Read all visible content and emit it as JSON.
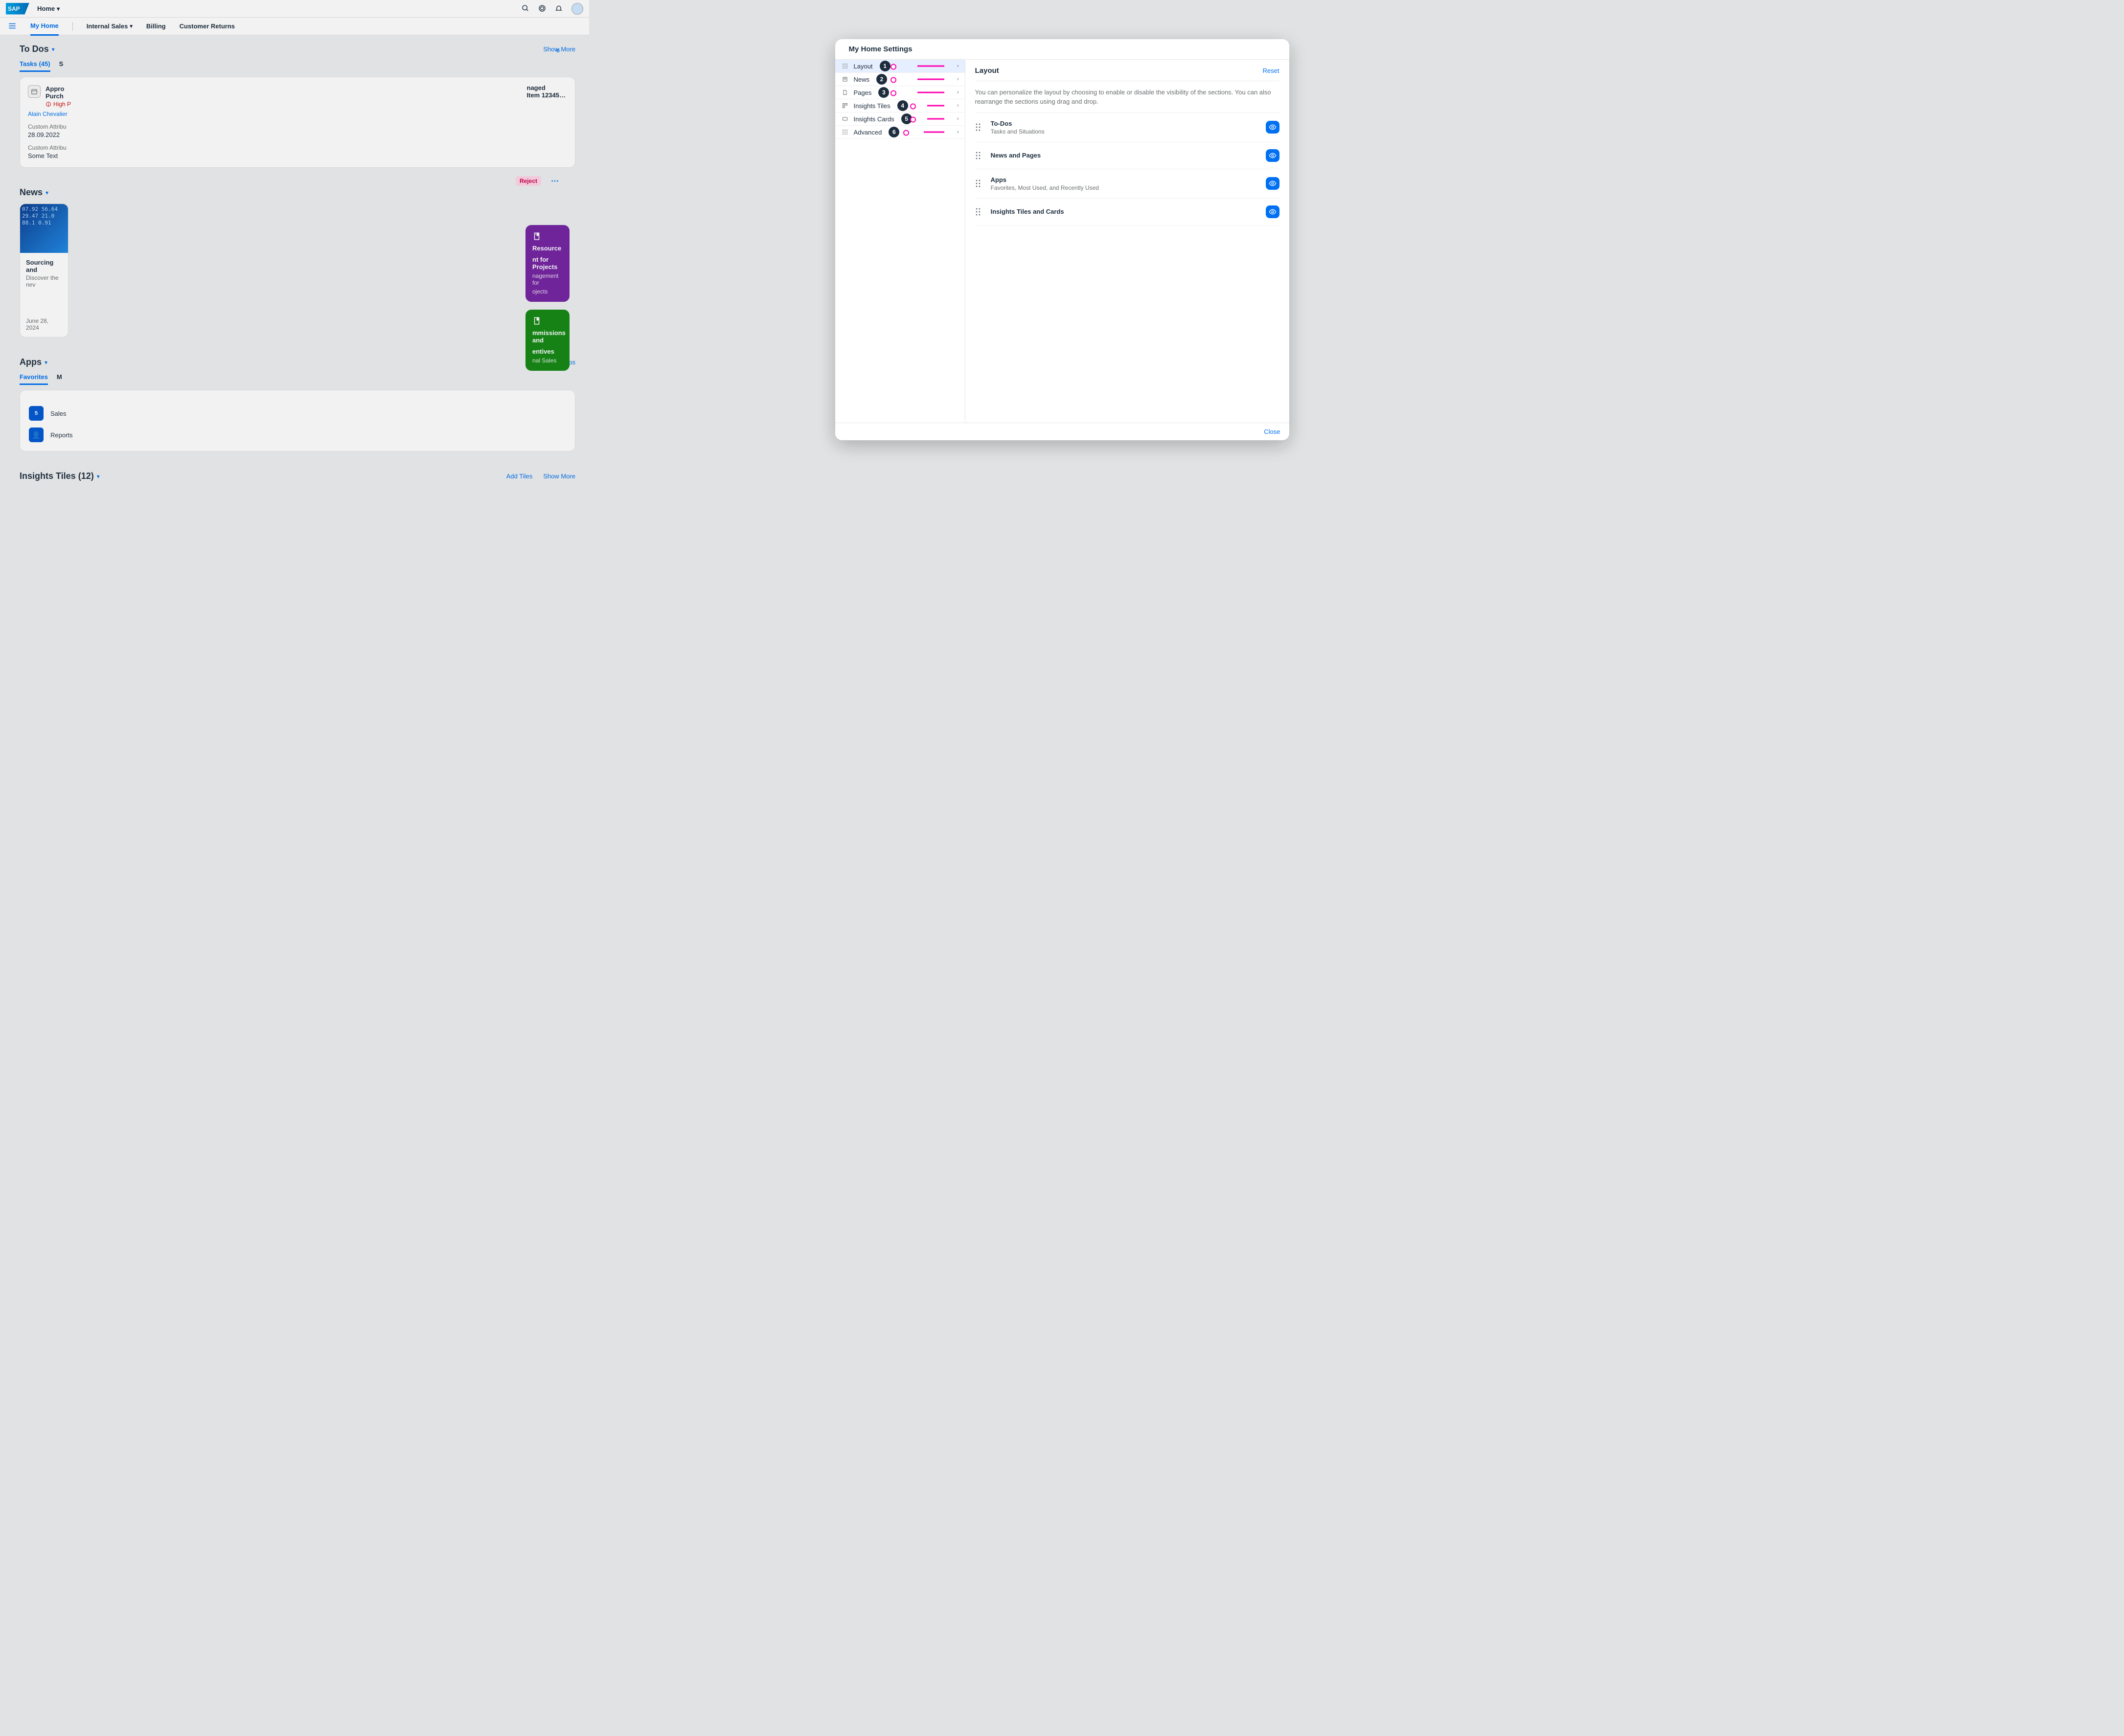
{
  "shell": {
    "logo": "SAP",
    "home_label": "Home"
  },
  "tabs": {
    "my_home": "My Home",
    "internal_sales": "Internal Sales",
    "billing": "Billing",
    "customer_returns": "Customer Returns"
  },
  "todos": {
    "heading": "To Dos",
    "subtabs": {
      "tasks": "Tasks (45)",
      "second": "S"
    },
    "show_more": "Show More",
    "task": {
      "title_line1": "Appro",
      "title_line2": "Purch",
      "priority": "High P",
      "person": "Alain Chevalier",
      "attr1_label": "Custom Attribu",
      "attr1_value": "28.09.2022",
      "attr2_label": "Custom Attribu",
      "attr2_value": "Some Text",
      "reject": "Reject",
      "peek_right_line1": "naged",
      "peek_right_line2": "Item 12345…",
      "peek_right_o": "o"
    }
  },
  "news": {
    "heading": "News",
    "card": {
      "title": "Sourcing and",
      "desc": "Discover the nev",
      "date": "June 28, 2024"
    }
  },
  "apps": {
    "heading": "Apps",
    "add": "Add Apps",
    "subtab_fav": "Favorites",
    "subtab_m": "M",
    "fav1_count": "5",
    "fav1_label": "Sales",
    "fav2_label": "Reports",
    "pill1_t": "Resource",
    "pill1_sub": "nt for Projects",
    "pill1_d": "nagement for",
    "pill1_d2": "ojects",
    "pill2_t": "mmissions and",
    "pill2_sub": "entives",
    "pill2_d": "nal Sales"
  },
  "insights": {
    "heading": "Insights Tiles (12)",
    "add_tiles": "Add Tiles",
    "show_more": "Show More"
  },
  "dialog": {
    "title": "My Home Settings",
    "nav": [
      {
        "label": "Layout",
        "badge": "1",
        "selected": true
      },
      {
        "label": "News",
        "badge": "2"
      },
      {
        "label": "Pages",
        "badge": "3"
      },
      {
        "label": "Insights Tiles",
        "badge": "4"
      },
      {
        "label": "Insights Cards",
        "badge": "5"
      },
      {
        "label": "Advanced",
        "badge": "6"
      }
    ],
    "panel_title": "Layout",
    "reset": "Reset",
    "help": "You can personalize the layout by choosing to enable or disable the visibility of the sections. You can also rearrange the sections using drag and drop.",
    "rows": [
      {
        "title": "To-Dos",
        "sub": "Tasks and Situations"
      },
      {
        "title": "News and Pages",
        "sub": ""
      },
      {
        "title": "Apps",
        "sub": "Favorites, Most Used, and Recently Used"
      },
      {
        "title": "Insights Tiles and Cards",
        "sub": ""
      }
    ],
    "close": "Close"
  }
}
